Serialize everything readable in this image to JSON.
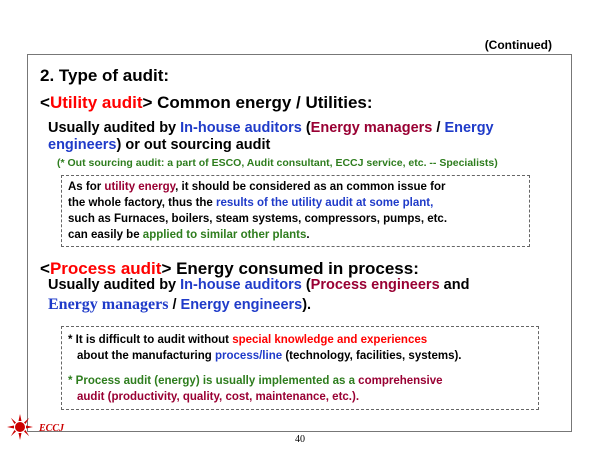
{
  "continued": "(Continued)",
  "heading": "2. Type of audit:",
  "utility": {
    "title_pre": "<",
    "title_tag": "Utility audit",
    "title_post": "> Common energy / Utilities:",
    "l1_a": "Usually audited by ",
    "l1_b": "In-house auditors",
    "l1_c": " (",
    "l1_d": "Energy managers",
    "l1_e": " / ",
    "l1_f": "Energy",
    "l2_a": "engineers",
    "l2_b": ") or out sourcing audit",
    "note": "(* Out sourcing audit: a part of ESCO, Audit consultant, ECCJ service, etc. -- Specialists)",
    "box": {
      "l1_a": "As for ",
      "l1_b": "utility energy",
      "l1_c": ", it should be considered as an common issue for",
      "l2_a": "the whole  factory, thus the ",
      "l2_b": "results of the utility audit at some plant,",
      "l3": "such as Furnaces, boilers, steam systems, compressors, pumps, etc.",
      "l4_a": "can easily be ",
      "l4_b": "applied to similar other plants",
      "l4_c": "."
    }
  },
  "process": {
    "title_pre": "<",
    "title_tag": "Process audit",
    "title_post": "> Energy consumed in process:",
    "l1_a": "Usually audited by ",
    "l1_b": "In-house auditors",
    "l1_c": " (",
    "l1_d": "Process engineers",
    "l1_e": " and",
    "l2_a": "Energy managers",
    "l2_b": " / ",
    "l2_c": "Energy engineers",
    "l2_d": ").",
    "box": {
      "l1_a": "*  It is difficult to audit without ",
      "l1_b": "special knowledge and experiences",
      "l2_a": "about the manufacturing ",
      "l2_b": "process/line",
      "l2_c": " (technology, facilities, systems).",
      "l3_a": "* Process audit (energy) is usually implemented as a ",
      "l3_b": "comprehensive",
      "l4": "audit (productivity, quality, cost, maintenance, etc.)."
    }
  },
  "logo": {
    "text": "ECCJ",
    "icon": "eccj-sun-logo-icon",
    "color": "#cc0000"
  },
  "page_number": "40"
}
